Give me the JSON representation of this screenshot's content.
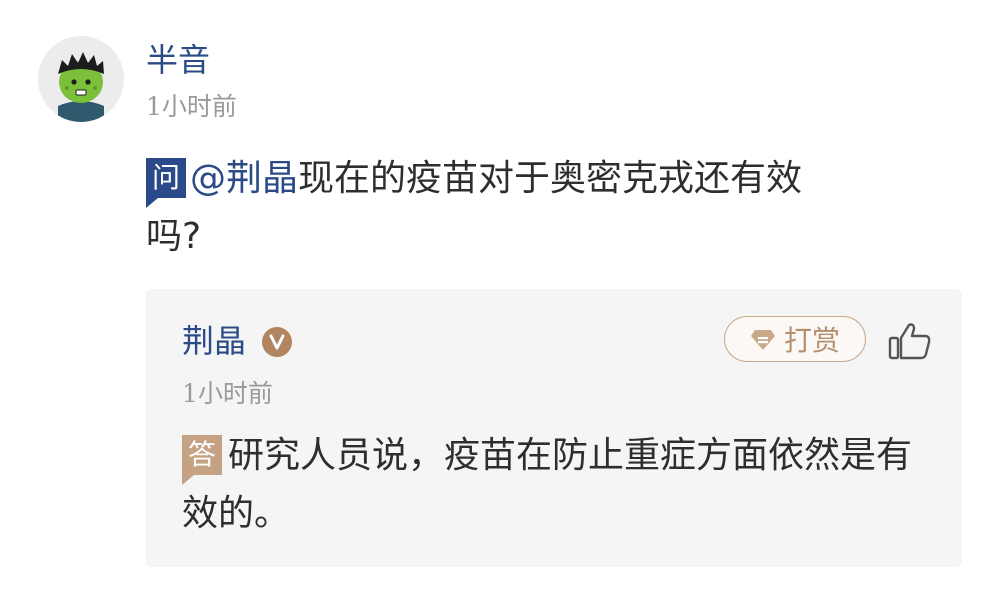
{
  "question_post": {
    "author_name": "半音",
    "time": "1小时前",
    "badge": "问",
    "mention": "@荆晶",
    "text": "现在的疫苗对于奥密克戎还有效吗?"
  },
  "answer_post": {
    "author_name": "荆晶",
    "verified_icon": "verified-v-icon",
    "tip_label": "打赏",
    "like_icon": "thumbs-up-icon",
    "time": "1小时前",
    "badge": "答",
    "text": "研究人员说，疫苗在防止重症方面依然是有效的。"
  },
  "colors": {
    "name_blue": "#2b4b86",
    "question_badge": "#2a4a8a",
    "answer_badge": "#c5a283",
    "card_bg": "#f5f5f5",
    "muted_text": "#9a9a9a"
  }
}
